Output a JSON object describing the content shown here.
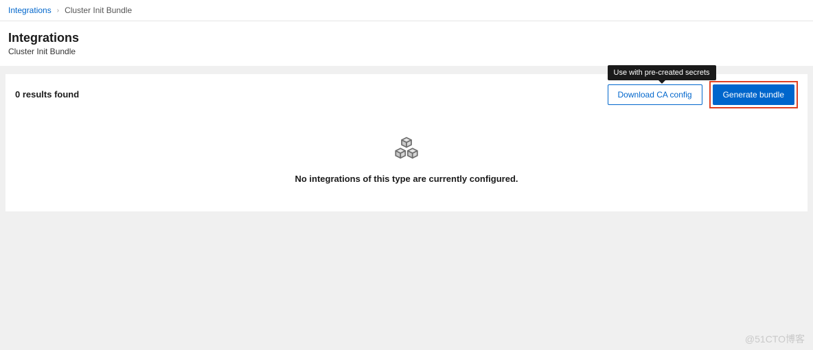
{
  "breadcrumb": {
    "parent": "Integrations",
    "separator": "›",
    "current": "Cluster Init Bundle"
  },
  "header": {
    "title": "Integrations",
    "subtitle": "Cluster Init Bundle"
  },
  "toolbar": {
    "results_text": "0 results found",
    "tooltip_text": "Use with pre-created secrets",
    "download_ca_label": "Download CA config",
    "generate_bundle_label": "Generate bundle"
  },
  "empty_state": {
    "message": "No integrations of this type are currently configured."
  },
  "watermark": "@51CTO博客"
}
